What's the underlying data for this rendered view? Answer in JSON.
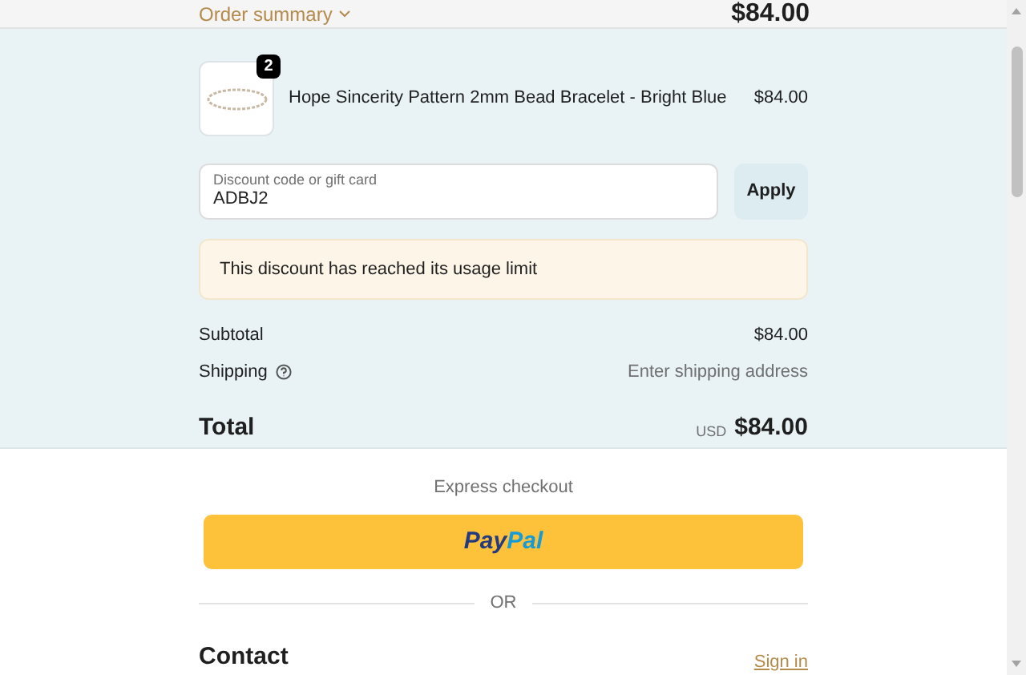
{
  "summary_toggle": {
    "label": "Order summary",
    "total": "$84.00"
  },
  "items": [
    {
      "name": "Hope Sincerity Pattern 2mm Bead Bracelet - Bright Blue",
      "quantity": "2",
      "price": "$84.00"
    }
  ],
  "discount": {
    "placeholder": "Discount code or gift card",
    "value": "ADBJ2",
    "button": "Apply",
    "error": "This discount has reached its usage limit"
  },
  "totals": [
    {
      "label": "Subtotal",
      "value": "$84.00",
      "kind": "plain"
    },
    {
      "label": "Shipping",
      "value": "Enter shipping address",
      "kind": "hint"
    }
  ],
  "total": {
    "label": "Total",
    "currency": "USD",
    "value": "$84.00"
  },
  "express": {
    "title": "Express checkout",
    "logo_parts": [
      "Pay",
      "Pal"
    ],
    "divider": "OR"
  },
  "contact": {
    "title": "Contact",
    "link": "Sign in"
  }
}
